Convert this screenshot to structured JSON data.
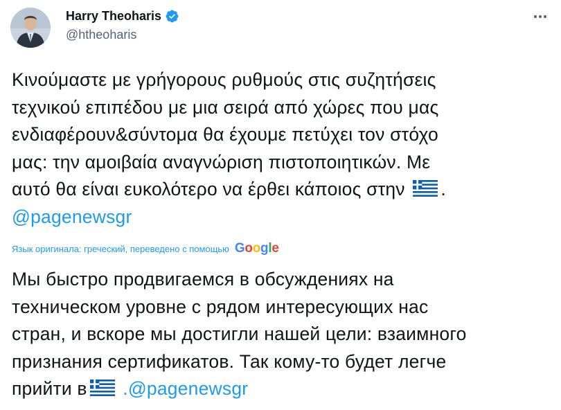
{
  "author": {
    "display_name": "Harry Theoharis",
    "handle": "@htheoharis",
    "verified_icon": "verified-badge-icon"
  },
  "tweet": {
    "lines": [
      "Κινούμαστε με γρήγορους ρυθμούς στις συζητήσεις",
      "τεχνικού επιπέδου με μια σειρά από χώρες που μας",
      "ενδιαφέρουν&σύντομα θα έχουμε πετύχει τον στόχο",
      "μας: την αμοιβαία αναγνώριση πιστοποιητικών. Με"
    ],
    "line5_text": "αυτό θα είναι ευκολότερο να έρθει κάποιος στην",
    "line5_end": ".",
    "mention": "@pagenewsgr"
  },
  "translation_bar": {
    "label": "Язык оригинала: греческий, переведено с помощью",
    "provider": "Google"
  },
  "translation": {
    "lines": [
      "Мы быстро продвигаемся в обсуждениях на",
      "техническом уровне с рядом интересующих нас",
      "стран, и вскоре мы достигли нашей цели: взаимного",
      "признания сертификатов. Так кому-то будет легче"
    ],
    "last_line_text": "прийти в",
    "last_line_mention": ".@pagenewsgr"
  },
  "colors": {
    "accent": "#1d9bf0",
    "text": "#0f1419",
    "secondary": "#536471"
  }
}
